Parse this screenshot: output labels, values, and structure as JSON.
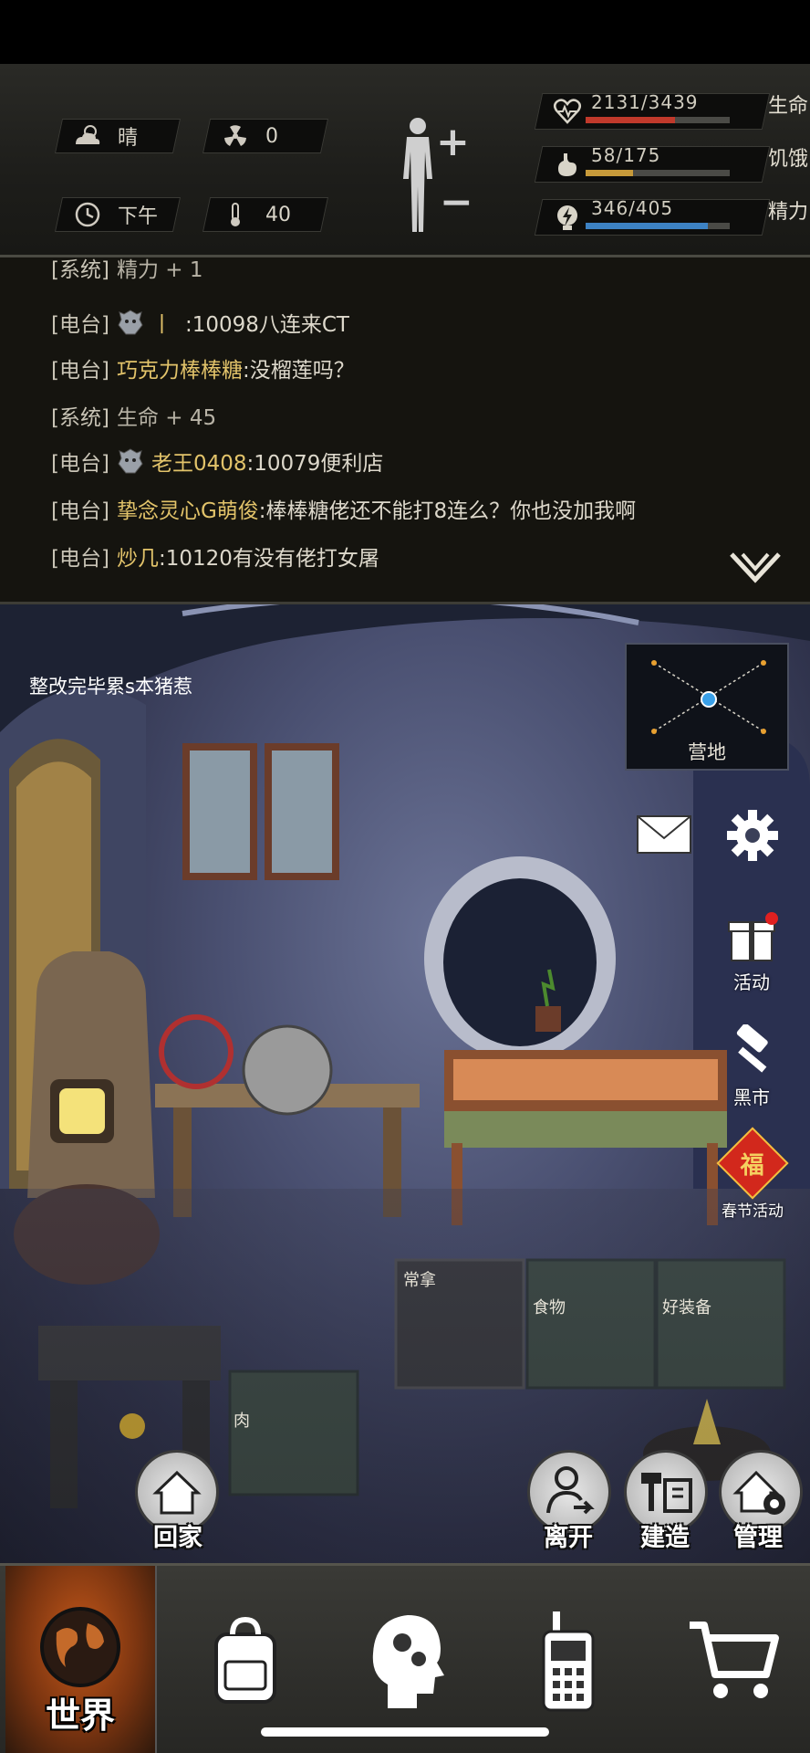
{
  "hud": {
    "weather": "晴",
    "radiation": "0",
    "time_of_day": "下午",
    "temperature": "40",
    "body_plus": "+",
    "body_minus": "−",
    "stats": [
      {
        "value": "2131/3439",
        "label": "生命",
        "fill_fraction": 0.62,
        "color": "#c0392b",
        "icon": "heart-icon"
      },
      {
        "value": "58/175",
        "label": "饥饿",
        "fill_fraction": 0.33,
        "color": "#c79a3a",
        "icon": "stomach-icon"
      },
      {
        "value": "346/405",
        "label": "精力",
        "fill_fraction": 0.85,
        "color": "#3d82c4",
        "icon": "energy-icon"
      }
    ]
  },
  "chat": {
    "lines": [
      {
        "tag": "[系统]",
        "user": "",
        "msg": "精力 + 1",
        "kind": "system"
      },
      {
        "tag": "[电台]",
        "user": "丨",
        "msg": ":10098八连来CT",
        "kind": "radio",
        "badge": true
      },
      {
        "tag": "[电台]",
        "user": "巧克力棒棒糖",
        "msg": ":没榴莲吗？",
        "kind": "radio",
        "badge": false
      },
      {
        "tag": "[系统]",
        "user": "",
        "msg": "生命 + 45",
        "kind": "system"
      },
      {
        "tag": "[电台]",
        "user": "老王0408",
        "msg": ":10079便利店",
        "kind": "radio",
        "badge": true
      },
      {
        "tag": "[电台]",
        "user": "挚念灵心G萌俊",
        "msg": ":棒棒糖佬还不能打8连么？你也没加我啊",
        "kind": "radio",
        "badge": false
      },
      {
        "tag": "[电台]",
        "user": "炒几",
        "msg": ":10120有没有佬打女屠",
        "kind": "radio",
        "badge": false
      }
    ]
  },
  "scene": {
    "camp_title": "整改完毕累s本猪惹",
    "minimap_label": "营地",
    "side_buttons": {
      "activity": "活动",
      "black_market": "黑市",
      "spring_festival": "春节活动",
      "fortune_char": "福"
    },
    "crates": {
      "common": "常拿",
      "food": "食物",
      "good_gear": "好装备",
      "meat": "肉"
    },
    "actions": {
      "home": "回家",
      "leave": "离开",
      "build": "建造",
      "manage": "管理"
    }
  },
  "nav": {
    "world": "世界"
  }
}
